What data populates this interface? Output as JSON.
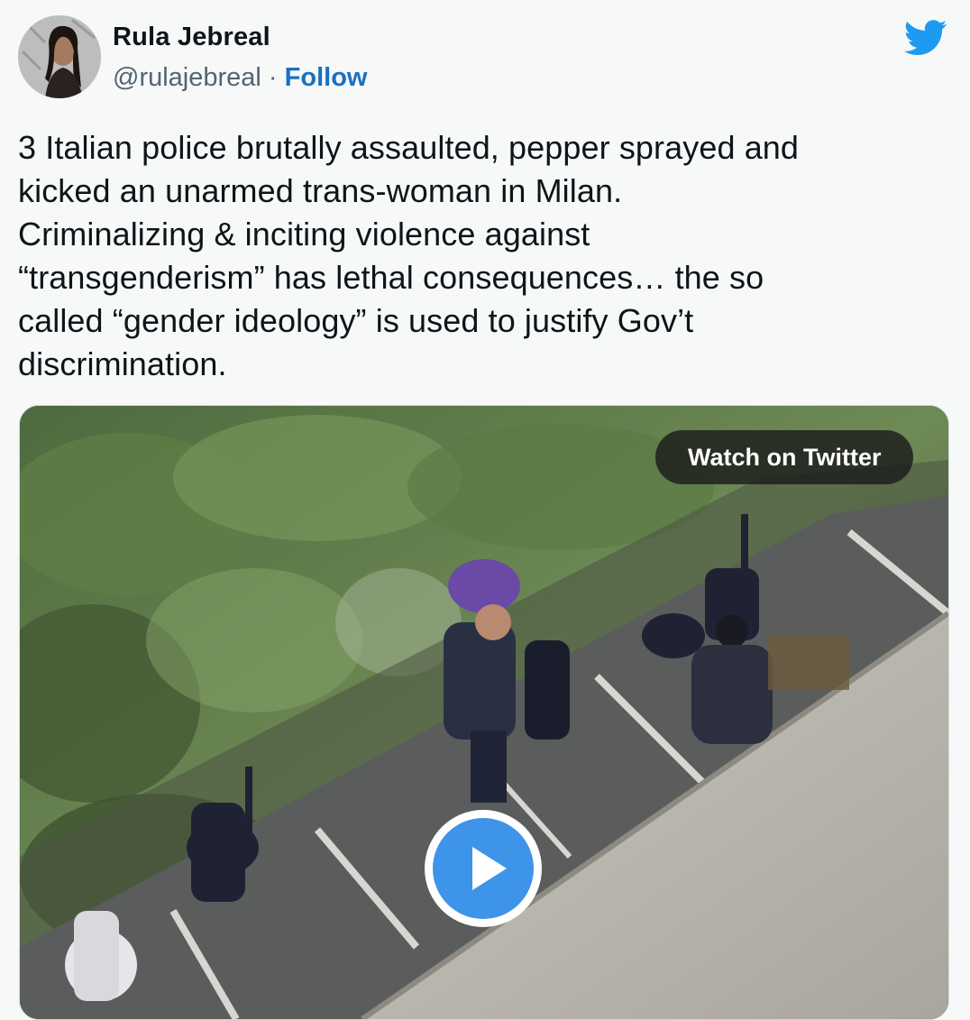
{
  "author": {
    "name": "Rula Jebreal",
    "handle": "@rulajebreal",
    "separator": "·",
    "follow_label": "Follow"
  },
  "tweet": {
    "text": "3 Italian police brutally assaulted, pepper sprayed and\nkicked an unarmed trans-woman in Milan.\nCriminalizing & inciting violence against\n“transgenderism” has lethal consequences… the so\ncalled “gender ideology” is used to justify Gov’t\ndiscrimination."
  },
  "media": {
    "type": "video",
    "watch_label": "Watch on Twitter"
  },
  "icons": {
    "brand": "twitter-bird-icon",
    "play": "play-icon"
  },
  "colors": {
    "follow": "#1d6fc2",
    "twitter_blue": "#1d9bf0",
    "play_button": "#3d94e8",
    "background": "#f7f9f9"
  }
}
